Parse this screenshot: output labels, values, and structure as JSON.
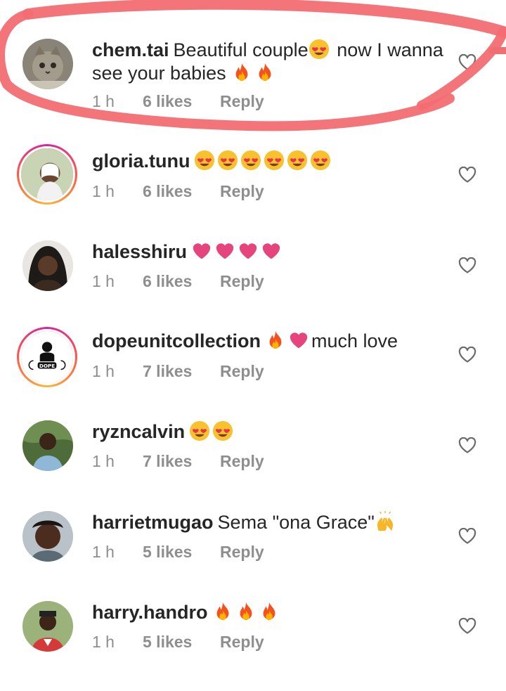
{
  "comments": [
    {
      "username": "chem.tai",
      "text": "Beautiful couple",
      "text_after": "now I wanna see your babies",
      "time": "1 h",
      "likes": "6 likes",
      "reply": "Reply"
    },
    {
      "username": "gloria.tunu",
      "text": "",
      "time": "1 h",
      "likes": "6 likes",
      "reply": "Reply"
    },
    {
      "username": "halesshiru",
      "text": "",
      "time": "1 h",
      "likes": "6 likes",
      "reply": "Reply"
    },
    {
      "username": "dopeunitcollection",
      "text": "much love",
      "time": "1 h",
      "likes": "7 likes",
      "reply": "Reply",
      "avatar_text": "DOPE"
    },
    {
      "username": "ryzncalvin",
      "text": "",
      "time": "1 h",
      "likes": "7 likes",
      "reply": "Reply"
    },
    {
      "username": "harrietmugao",
      "text": "Sema \"ona Grace\"",
      "time": "1 h",
      "likes": "5 likes",
      "reply": "Reply"
    },
    {
      "username": "harry.handro",
      "text": "",
      "time": "1 h",
      "likes": "5 likes",
      "reply": "Reply"
    }
  ],
  "colors": {
    "highlight": "#f26d72",
    "meta": "#8e8e8e",
    "text": "#262626"
  },
  "icons": [
    "heart-eyes-emoji",
    "fire-emoji",
    "pink-heart-emoji",
    "raised-hands-emoji",
    "heart-outline-icon"
  ]
}
